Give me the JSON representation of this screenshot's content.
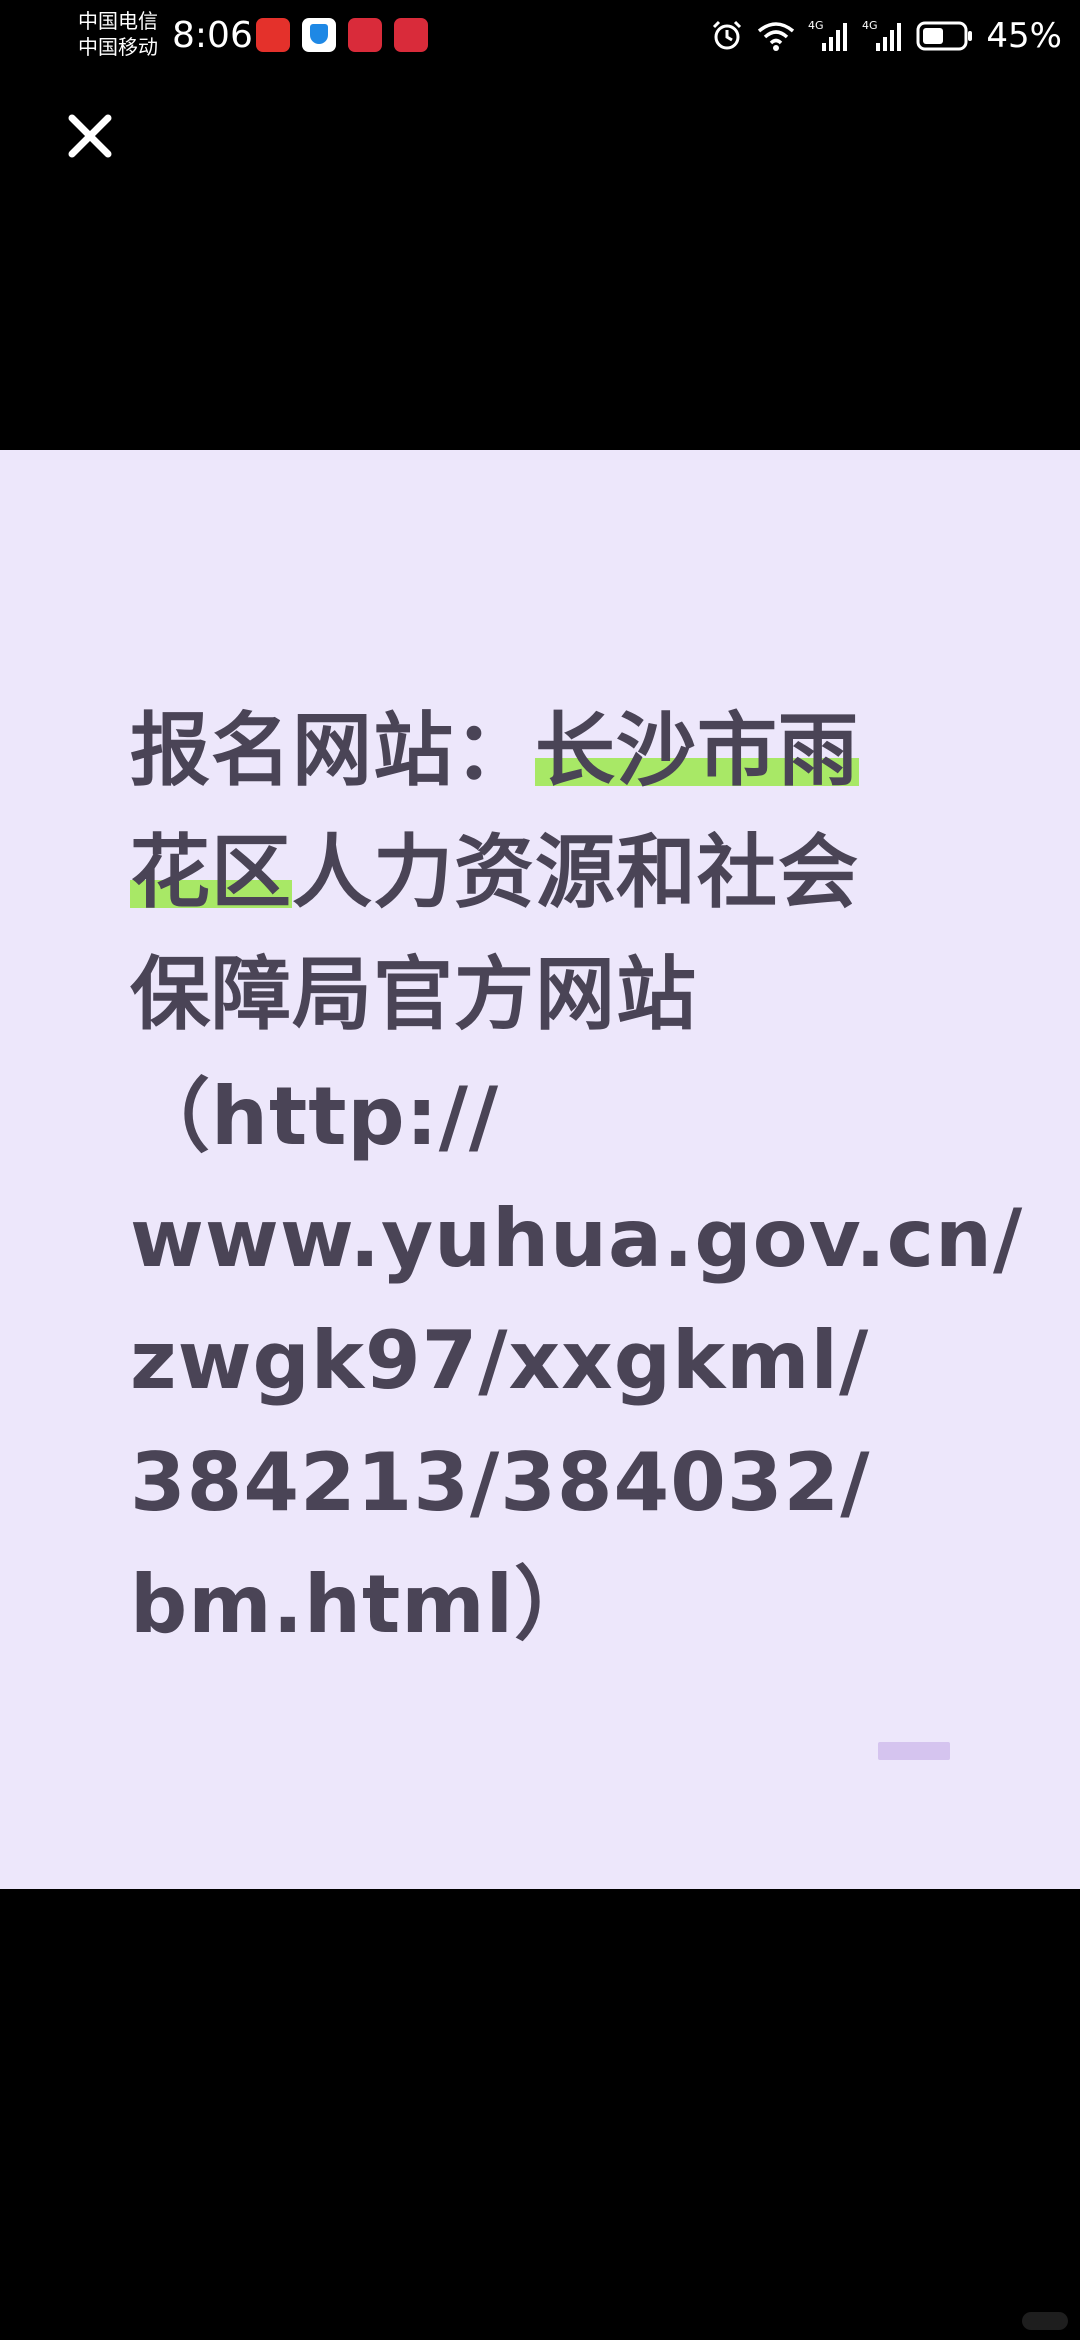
{
  "status_bar": {
    "carrier_1": "中国电信",
    "carrier_2": "中国移动",
    "time": "8:06",
    "network_1": "4G",
    "network_2": "4G",
    "battery_percent": "45%",
    "notification_icons": [
      "red-app-icon",
      "shield-app-icon",
      "news-app-icon",
      "news-app-icon"
    ],
    "system_icons": [
      "alarm-icon",
      "wifi-icon",
      "signal-icon",
      "signal-icon",
      "battery-icon"
    ]
  },
  "viewer": {
    "close_icon": "close-icon"
  },
  "card": {
    "lines": [
      {
        "pre": "报名网站：",
        "hl": "长沙市雨",
        "post": ""
      },
      {
        "pre": "",
        "hl": "花区",
        "post": "人力资源和社会"
      },
      {
        "pre": "保障局官方网站",
        "hl": "",
        "post": ""
      },
      {
        "pre": "（http://",
        "hl": "",
        "post": ""
      },
      {
        "pre": "www.yuhua.gov.cn/",
        "hl": "",
        "post": ""
      },
      {
        "pre": "zwgk97/xxgkml/",
        "hl": "",
        "post": ""
      },
      {
        "pre": "384213/384032/",
        "hl": "",
        "post": ""
      },
      {
        "pre": "bm.html）",
        "hl": "",
        "post": ""
      }
    ]
  },
  "colors": {
    "background": "#000000",
    "card_background": "#ede7fb",
    "text": "#4a4456",
    "highlight": "#a8e866",
    "accent_bar": "#d5c4ef"
  }
}
